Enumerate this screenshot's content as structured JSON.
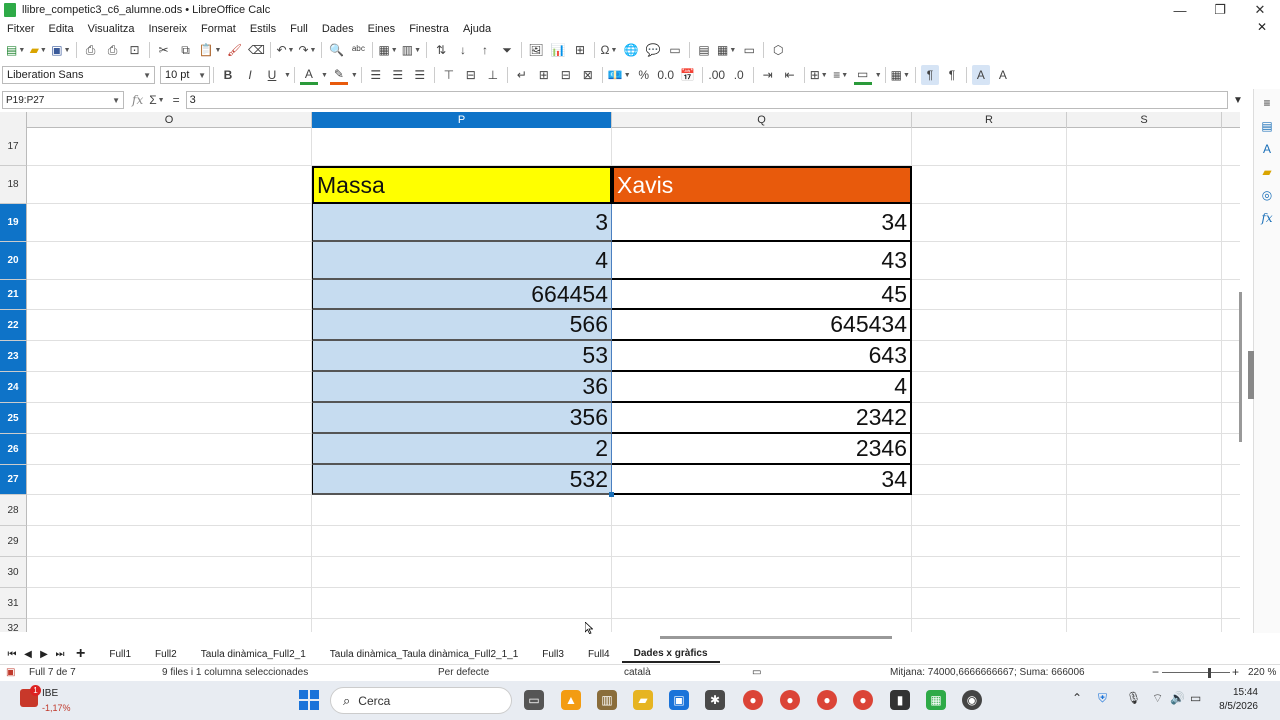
{
  "window": {
    "title": "llibre_competic3_c6_alumne.ods • LibreOffice Calc",
    "minimize": "—",
    "maximize": "❐",
    "close": "✕"
  },
  "menu": [
    "Fitxer",
    "Edita",
    "Visualitza",
    "Insereix",
    "Format",
    "Estils",
    "Full",
    "Dades",
    "Eines",
    "Finestra",
    "Ajuda"
  ],
  "menu_close_doc": "✕",
  "format_toolbar": {
    "font_name": "Liberation Sans",
    "font_size": "10 pt",
    "bold": "B",
    "italic": "I",
    "underline": "U",
    "percent": "%",
    "decimal": "0.0"
  },
  "formula_bar": {
    "name_box": "P19:P27",
    "fx": "fx",
    "sigma": "Σ",
    "equals": "=",
    "content": "3"
  },
  "columns": [
    {
      "label": "O",
      "selected": false
    },
    {
      "label": "P",
      "selected": true
    },
    {
      "label": "Q",
      "selected": false
    },
    {
      "label": "R",
      "selected": false
    },
    {
      "label": "S",
      "selected": false
    }
  ],
  "rows": [
    {
      "label": "17",
      "selected": false
    },
    {
      "label": "18",
      "selected": false
    },
    {
      "label": "19",
      "selected": true
    },
    {
      "label": "20",
      "selected": true
    },
    {
      "label": "21",
      "selected": true
    },
    {
      "label": "22",
      "selected": true
    },
    {
      "label": "23",
      "selected": true
    },
    {
      "label": "24",
      "selected": true
    },
    {
      "label": "25",
      "selected": true
    },
    {
      "label": "26",
      "selected": true
    },
    {
      "label": "27",
      "selected": true
    },
    {
      "label": "28",
      "selected": false
    },
    {
      "label": "29",
      "selected": false
    },
    {
      "label": "30",
      "selected": false
    },
    {
      "label": "31",
      "selected": false
    },
    {
      "label": "32",
      "selected": false
    }
  ],
  "table": {
    "headers": [
      "Massa",
      "Xavis"
    ],
    "header_colors": [
      "#ffff00",
      "#e85a0c"
    ],
    "massa": [
      "3",
      "4",
      "664454",
      "566",
      "53",
      "36",
      "356",
      "2",
      "532"
    ],
    "xavis": [
      "34",
      "43",
      "45",
      "645434",
      "643",
      "4",
      "2342",
      "2346",
      "34"
    ]
  },
  "sheet_tabs": [
    {
      "label": "Full1",
      "active": false
    },
    {
      "label": "Full2",
      "active": false
    },
    {
      "label": "Taula dinàmica_Full2_1",
      "active": false
    },
    {
      "label": "Taula dinàmica_Taula dinàmica_Full2_1_1",
      "active": false
    },
    {
      "label": "Full3",
      "active": false
    },
    {
      "label": "Full4",
      "active": false
    },
    {
      "label": "Dades x gràfics",
      "active": true
    }
  ],
  "status": {
    "sheet": "Full 7 de 7",
    "selection": "9 files i 1 columna seleccionades",
    "style": "Per defecte",
    "language": "català",
    "sum": "Mitjana: 74000,6666666667; Suma: 666006",
    "zoom": "220 %",
    "zoom_minus": "−",
    "zoom_plus": "+"
  },
  "taskbar": {
    "weather_badge": "1",
    "weather_name": "IBE",
    "weather_value": "-1,17%",
    "search_placeholder": "Cerca",
    "time": "15:44",
    "date": "8/5/2026"
  }
}
